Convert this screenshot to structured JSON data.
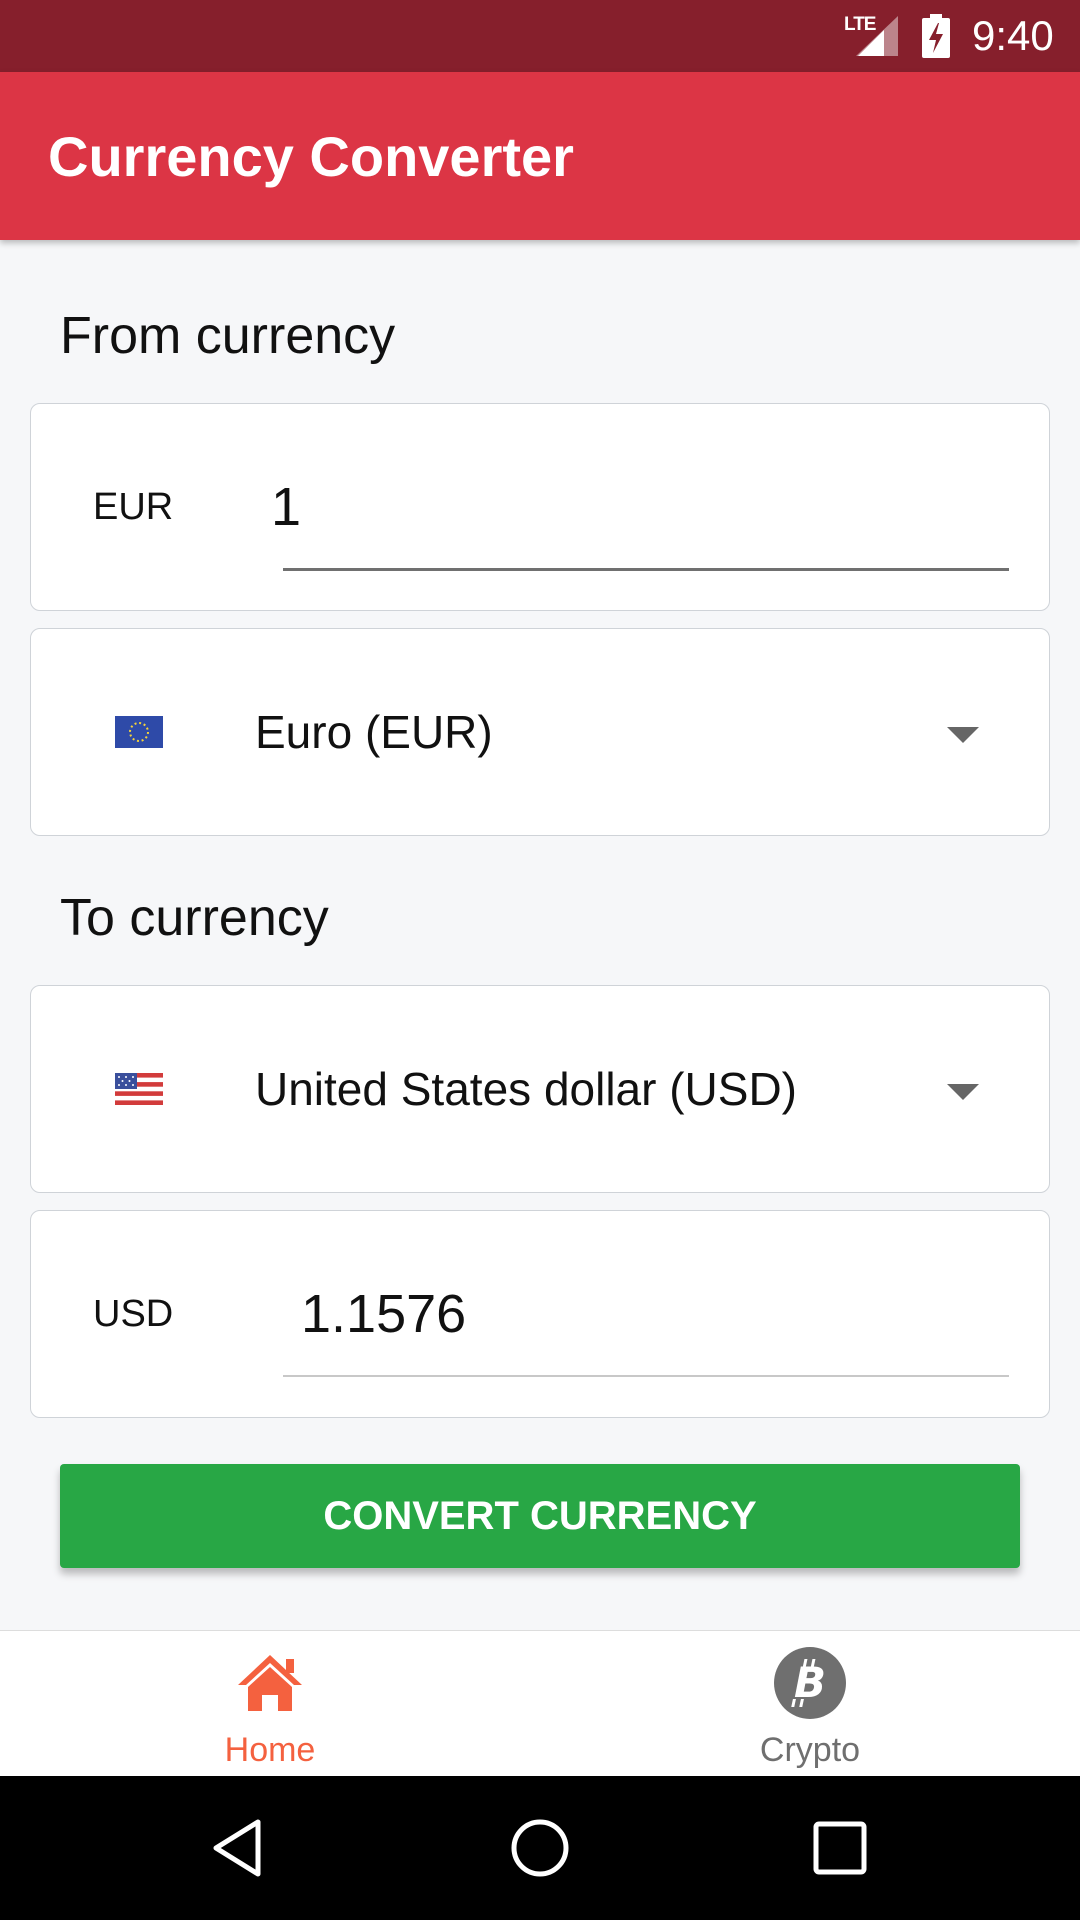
{
  "status_bar": {
    "network": "LTE",
    "time": "9:40"
  },
  "app_bar": {
    "title": "Currency Converter"
  },
  "from_section": {
    "label": "From currency",
    "code": "EUR",
    "amount": "1",
    "selected_currency": "Euro (EUR)",
    "flag_icon": "eu-flag-icon"
  },
  "to_section": {
    "label": "To currency",
    "selected_currency": "United States dollar (USD)",
    "flag_icon": "us-flag-icon",
    "code": "USD",
    "result": "1.1576"
  },
  "convert_button": {
    "label": "CONVERT CURRENCY",
    "color": "#28a745"
  },
  "bottom_nav": {
    "items": [
      {
        "label": "Home",
        "icon": "home-icon",
        "active": true,
        "color": "#f4613f"
      },
      {
        "label": "Crypto",
        "icon": "bitcoin-icon",
        "active": false,
        "color": "#6f6f6f"
      }
    ]
  },
  "system_nav": {
    "buttons": [
      "back-icon",
      "home-circle-icon",
      "recents-icon"
    ]
  },
  "colors": {
    "status_bar": "#861f2c",
    "app_bar": "#dc3545",
    "background": "#f6f7f9"
  }
}
